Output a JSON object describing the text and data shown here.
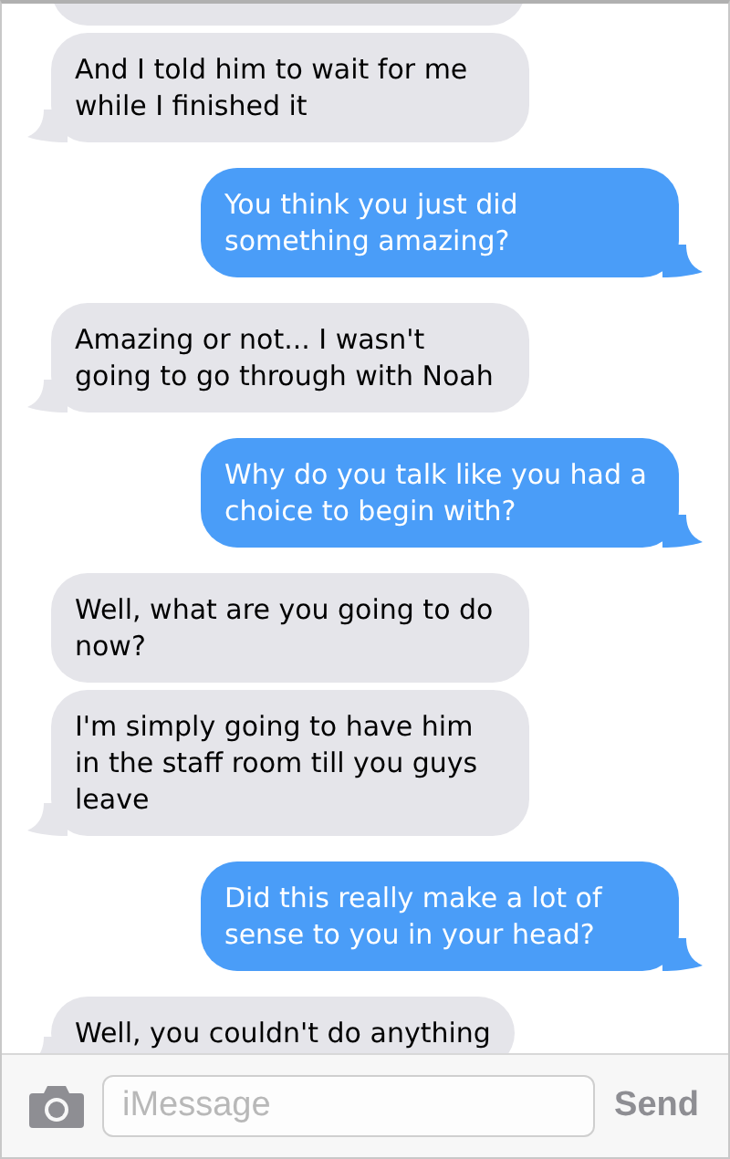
{
  "messages": [
    {
      "kind": "incoming"
    },
    {
      "kind": "incoming",
      "text": "And I told him to wait for me while I finished it"
    },
    {
      "kind": "outgoing",
      "text": "You think you just did something amazing?"
    },
    {
      "kind": "incoming",
      "text": "Amazing or not... I wasn't going to go through with Noah"
    },
    {
      "kind": "outgoing",
      "text": "Why do you talk like you had a choice to begin with?"
    },
    {
      "kind": "incoming",
      "text": "Well, what are you going to do now?"
    },
    {
      "kind": "incoming",
      "text": "I'm simply going to have him in the staff room till you guys leave"
    },
    {
      "kind": "outgoing",
      "text": "Did this really make a lot of sense to you in your head?"
    },
    {
      "kind": "incoming",
      "text": "Well, you couldn't do anything"
    }
  ],
  "composer": {
    "placeholder": "iMessage",
    "send": "Send"
  }
}
